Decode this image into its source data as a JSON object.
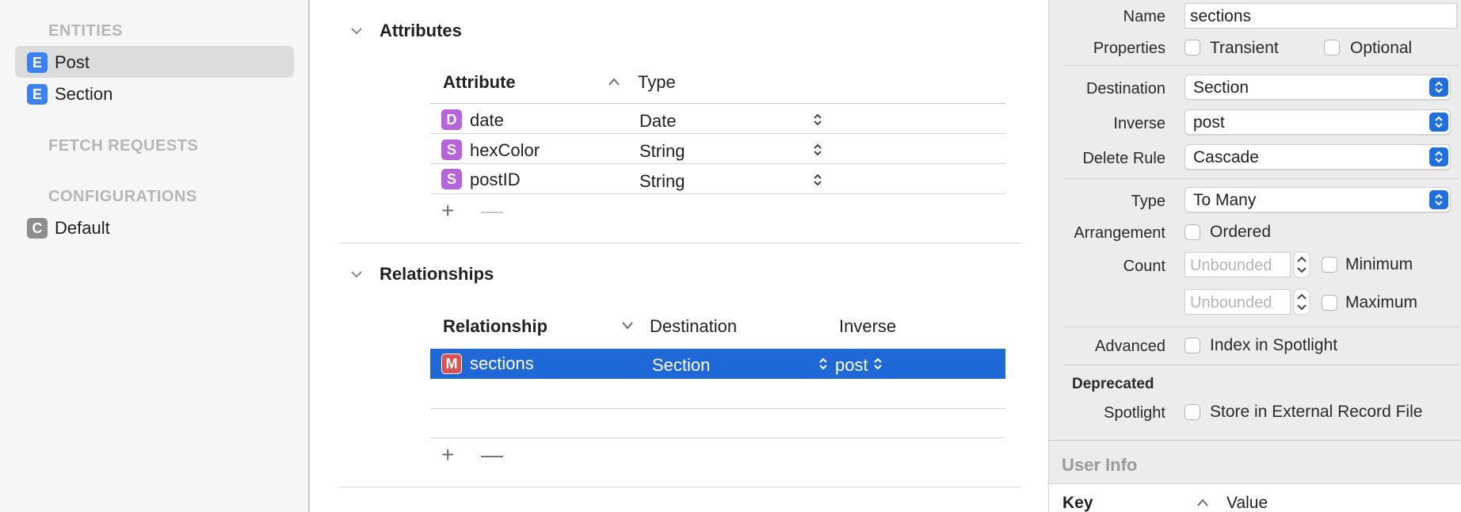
{
  "sidebar": {
    "entities_header": "ENTITIES",
    "entities": [
      {
        "badge": "E",
        "label": "Post",
        "selected": true
      },
      {
        "badge": "E",
        "label": "Section",
        "selected": false
      }
    ],
    "fetch_requests_header": "FETCH REQUESTS",
    "configurations_header": "CONFIGURATIONS",
    "configurations": [
      {
        "badge": "C",
        "label": "Default"
      }
    ]
  },
  "attributes": {
    "title": "Attributes",
    "columns": {
      "attribute": "Attribute",
      "type": "Type"
    },
    "rows": [
      {
        "badge": "D",
        "name": "date",
        "type": "Date"
      },
      {
        "badge": "S",
        "name": "hexColor",
        "type": "String"
      },
      {
        "badge": "S",
        "name": "postID",
        "type": "String"
      }
    ],
    "add_symbol": "+",
    "remove_symbol": "—"
  },
  "relationships": {
    "title": "Relationships",
    "columns": {
      "relationship": "Relationship",
      "destination": "Destination",
      "inverse": "Inverse"
    },
    "rows": [
      {
        "badge": "M",
        "name": "sections",
        "destination": "Section",
        "inverse": "post",
        "selected": true
      }
    ],
    "add_symbol": "+",
    "remove_symbol": "—"
  },
  "inspector": {
    "name_label": "Name",
    "name_value": "sections",
    "properties_label": "Properties",
    "transient_label": "Transient",
    "optional_label": "Optional",
    "destination_label": "Destination",
    "destination_value": "Section",
    "inverse_label": "Inverse",
    "inverse_value": "post",
    "delete_rule_label": "Delete Rule",
    "delete_rule_value": "Cascade",
    "type_label": "Type",
    "type_value": "To Many",
    "arrangement_label": "Arrangement",
    "ordered_label": "Ordered",
    "count_label": "Count",
    "min_placeholder": "Unbounded",
    "minimum_label": "Minimum",
    "max_placeholder": "Unbounded",
    "maximum_label": "Maximum",
    "advanced_label": "Advanced",
    "index_spotlight_label": "Index in Spotlight",
    "deprecated_header": "Deprecated",
    "spotlight_label": "Spotlight",
    "external_record_label": "Store in External Record File",
    "user_info_header": "User Info",
    "key_column": "Key",
    "value_column": "Value"
  },
  "colors": {
    "accent": "#1f68d8",
    "entity_badge": "#3b82f0",
    "attribute_badge": "#b764dc",
    "relationship_badge": "#e05050"
  }
}
